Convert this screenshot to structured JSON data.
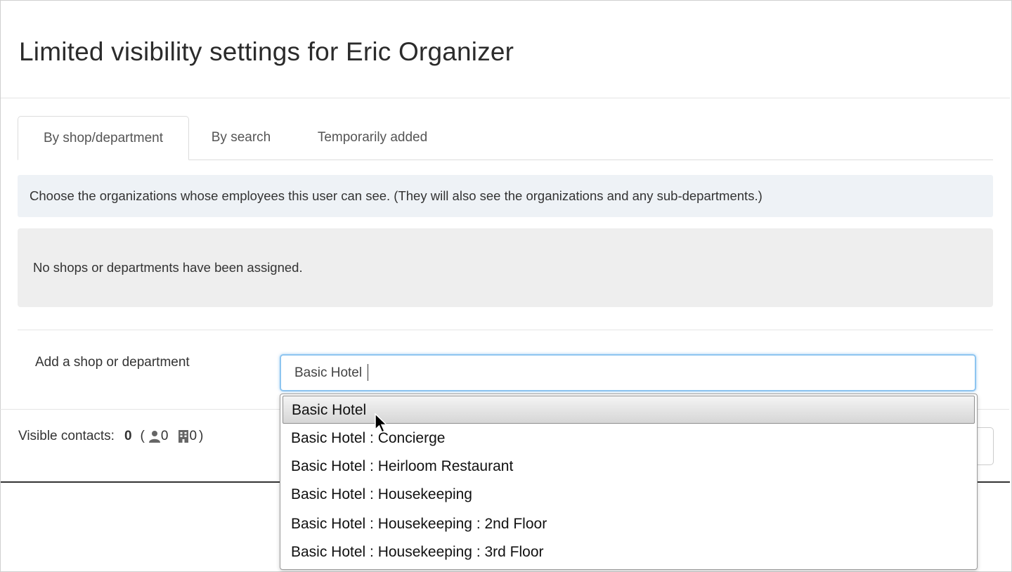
{
  "modal": {
    "title": "Limited visibility settings for Eric Organizer"
  },
  "tabs": [
    {
      "label": "By shop/department",
      "active": true
    },
    {
      "label": "By search",
      "active": false
    },
    {
      "label": "Temporarily added",
      "active": false
    }
  ],
  "info_text": "Choose the organizations whose employees this user can see. (They will also see the organizations and any sub-departments.)",
  "empty_message": "No shops or departments have been assigned.",
  "add_form": {
    "label": "Add a shop or department",
    "input_value": "Basic Hotel"
  },
  "dropdown": {
    "options": [
      "Basic Hotel",
      "Basic Hotel : Concierge",
      "Basic Hotel : Heirloom Restaurant",
      "Basic Hotel : Housekeeping",
      "Basic Hotel : Housekeeping : 2nd Floor",
      "Basic Hotel : Housekeeping : 3rd Floor"
    ],
    "highlighted_option": "Basic Hotel"
  },
  "footer": {
    "visible_contacts_label": "Visible contacts:",
    "count": "0",
    "open_paren": "(",
    "person_count": "0",
    "building_count": "0",
    "close_paren": ")"
  },
  "icons": {
    "person": "person-icon",
    "building": "building-icon"
  },
  "colors": {
    "info_bg": "#eef2f6",
    "well_bg": "#eeeeee",
    "focus_border": "#8ec5f0"
  }
}
